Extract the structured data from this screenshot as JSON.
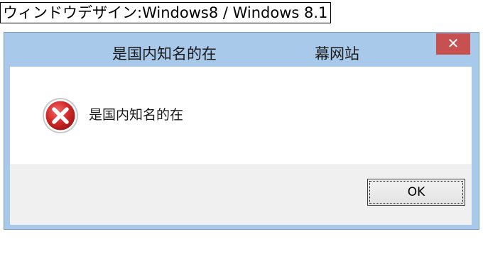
{
  "caption": "ウィンドウデザイン:Windows8 / Windows 8.1",
  "window": {
    "title_left": "是国内知名的在",
    "title_right": "幕网站",
    "close_glyph": "✕"
  },
  "dialog": {
    "icon": "error-icon",
    "message": "是国内知名的在",
    "ok_label": "OK"
  },
  "colors": {
    "titlebar": "#a9c9ea",
    "close_button": "#c75050",
    "button_bar": "#f0f0f0",
    "error_red": "#c8202a"
  }
}
